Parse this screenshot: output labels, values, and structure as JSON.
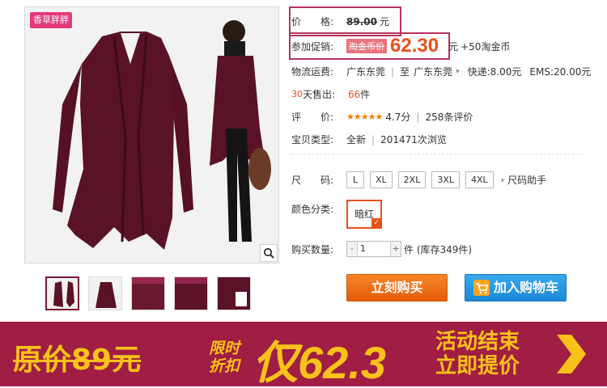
{
  "product": {
    "brand_tag": "香草胖胖",
    "thumbnails": [
      "thumb-1",
      "thumb-2",
      "thumb-3",
      "thumb-4",
      "thumb-5"
    ]
  },
  "price": {
    "label": "价　　格:",
    "original": "89.00",
    "unit": "元"
  },
  "promo": {
    "label": "参加促销:",
    "tag": "淘金币价",
    "price": "62.30",
    "unit": "元",
    "extra": "+50淘金币"
  },
  "shipping": {
    "label": "物流运费:",
    "from": "广东东莞",
    "to_prefix": "至",
    "to": "广东东莞",
    "express": "快递:8.00元",
    "ems": "EMS:20.00元"
  },
  "sales": {
    "days": "30",
    "label": "天售出:",
    "count": "66",
    "unit": "件"
  },
  "rating": {
    "label": "评　　价:",
    "stars": "★★★★★",
    "score": "4.7分",
    "reviews": "258条评价"
  },
  "type": {
    "label": "宝贝类型:",
    "condition": "全新",
    "views": "201471次浏览"
  },
  "size": {
    "label": "尺　　码:",
    "options": [
      "L",
      "XL",
      "2XL",
      "3XL",
      "4XL"
    ],
    "helper": "尺码助手"
  },
  "color": {
    "label": "颜色分类:",
    "selected": "暗红"
  },
  "quantity": {
    "label": "购买数量:",
    "minus": "-",
    "value": "1",
    "plus": "+",
    "stock": "件 (库存349件)"
  },
  "actions": {
    "buy_now": "立刻购买",
    "add_to_cart": "加入购物车"
  },
  "banner": {
    "original": "原价89元",
    "limited_1": "限时",
    "limited_2": "折扣",
    "price": "仅62.3",
    "end_1": "活动结束",
    "end_2": "立即提价"
  },
  "colors": {
    "accent": "#e8511a",
    "banner_bg": "#a01d43",
    "banner_text": "#f9c21a",
    "cart_blue": "#1c88d8",
    "highlight_border": "#b4345b"
  }
}
